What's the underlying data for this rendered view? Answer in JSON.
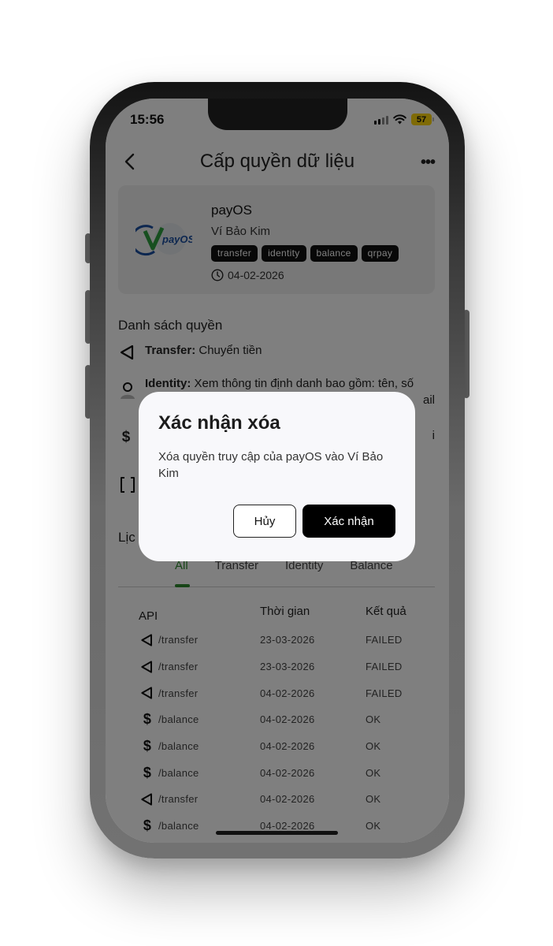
{
  "status_bar": {
    "time": "15:56",
    "battery": "57"
  },
  "header": {
    "title": "Cấp quyền dữ liệu"
  },
  "app": {
    "name": "payOS",
    "wallet": "Ví Bảo Kim",
    "tags": [
      "transfer",
      "identity",
      "balance",
      "qrpay"
    ],
    "date": "04-02-2026",
    "logo_text": "payOS"
  },
  "permissions": {
    "title": "Danh sách quyền",
    "items": [
      {
        "name": "Transfer:",
        "desc": " Chuyển tiền"
      },
      {
        "name": "Identity:",
        "desc": " Xem thông tin định danh bao gồm: tên, số",
        "desc2": "ail"
      },
      {
        "desc_fragment": "i"
      }
    ]
  },
  "history": {
    "title_fragment": "Lịc",
    "tabs": [
      "All",
      "Transfer",
      "Identity",
      "Balance"
    ],
    "active_tab": "All",
    "columns": [
      "API",
      "Thời gian",
      "Kết quả"
    ],
    "rows": [
      {
        "icon": "transfer-icon",
        "api": "/transfer",
        "time": "23-03-2026",
        "result": "FAILED"
      },
      {
        "icon": "transfer-icon",
        "api": "/transfer",
        "time": "23-03-2026",
        "result": "FAILED"
      },
      {
        "icon": "transfer-icon",
        "api": "/transfer",
        "time": "04-02-2026",
        "result": "FAILED"
      },
      {
        "icon": "balance-icon",
        "api": "/balance",
        "time": "04-02-2026",
        "result": "OK"
      },
      {
        "icon": "balance-icon",
        "api": "/balance",
        "time": "04-02-2026",
        "result": "OK"
      },
      {
        "icon": "balance-icon",
        "api": "/balance",
        "time": "04-02-2026",
        "result": "OK"
      },
      {
        "icon": "transfer-icon",
        "api": "/transfer",
        "time": "04-02-2026",
        "result": "OK"
      },
      {
        "icon": "balance-icon",
        "api": "/balance",
        "time": "04-02-2026",
        "result": "OK"
      }
    ]
  },
  "dialog": {
    "title": "Xác nhận xóa",
    "message": "Xóa quyền truy cập của payOS vào Ví Bảo Kim",
    "cancel_label": "Hủy",
    "confirm_label": "Xác nhận"
  },
  "colors": {
    "accent_green": "#2e8b2e",
    "tag_bg": "#111111",
    "battery": "#ffd60a"
  }
}
